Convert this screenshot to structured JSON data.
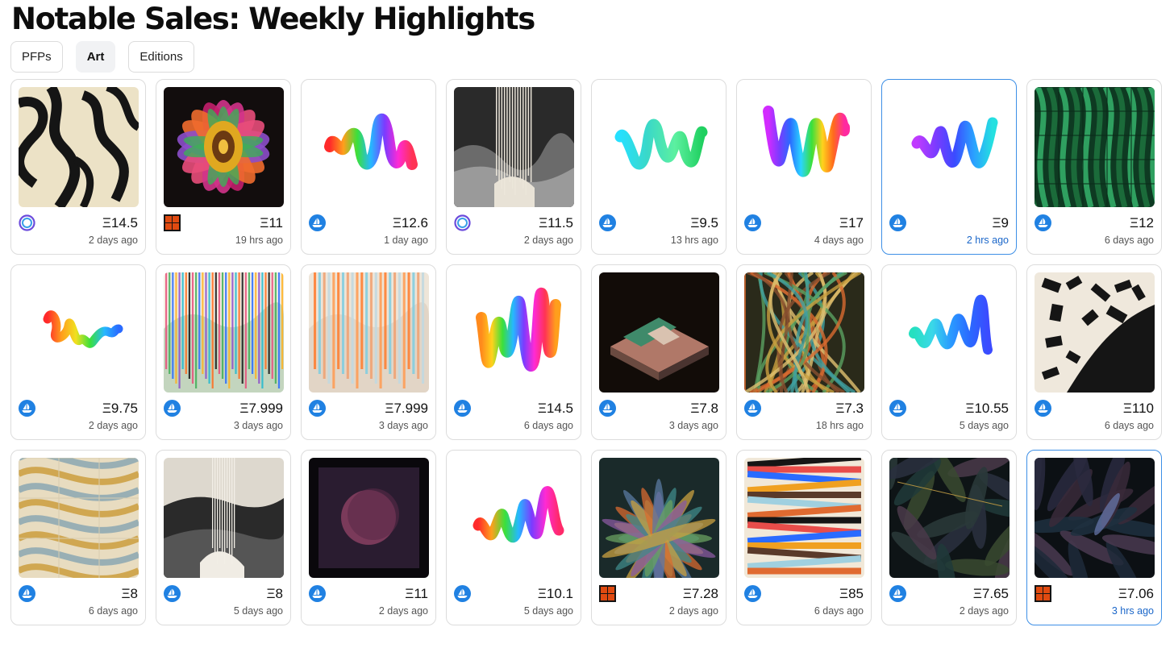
{
  "page": {
    "title": "Notable Sales: Weekly Highlights"
  },
  "tabs": [
    {
      "label": "PFPs",
      "active": false
    },
    {
      "label": "Art",
      "active": true
    },
    {
      "label": "Editions",
      "active": false
    }
  ],
  "colors": {
    "selected_border": "#3d8fe6",
    "selected_time": "#1a66c9",
    "opensea_blue": "#2081e2",
    "orange_badge": "#e04a10"
  },
  "sales": [
    {
      "price": "Ξ14.5",
      "time": "2 days ago",
      "marketplace_icon": "ring-icon",
      "artwork": "zebra-pattern",
      "selected": false
    },
    {
      "price": "Ξ11",
      "time": "19 hrs ago",
      "marketplace_icon": "orange-block-icon",
      "artwork": "psychedelic-flower",
      "selected": false
    },
    {
      "price": "Ξ12.6",
      "time": "1 day ago",
      "marketplace_icon": "opensea-icon",
      "artwork": "rainbow-squiggle",
      "selected": false
    },
    {
      "price": "Ξ11.5",
      "time": "2 days ago",
      "marketplace_icon": "ring-icon",
      "artwork": "grey-mountain-lines",
      "selected": false
    },
    {
      "price": "Ξ9.5",
      "time": "13 hrs ago",
      "marketplace_icon": "opensea-icon",
      "artwork": "cyan-squiggle",
      "selected": false
    },
    {
      "price": "Ξ17",
      "time": "4 days ago",
      "marketplace_icon": "opensea-icon",
      "artwork": "rainbow-squiggle-tall",
      "selected": false
    },
    {
      "price": "Ξ9",
      "time": "2 hrs ago",
      "marketplace_icon": "opensea-icon",
      "artwork": "purple-squiggle",
      "selected": true
    },
    {
      "price": "Ξ12",
      "time": "6 days ago",
      "marketplace_icon": "opensea-icon",
      "artwork": "green-malachite",
      "selected": false
    },
    {
      "price": "Ξ9.75",
      "time": "2 days ago",
      "marketplace_icon": "opensea-icon",
      "artwork": "small-rainbow-squiggle",
      "selected": false
    },
    {
      "price": "Ξ7.999",
      "time": "3 days ago",
      "marketplace_icon": "opensea-icon",
      "artwork": "color-vertical-lines",
      "selected": false
    },
    {
      "price": "Ξ7.999",
      "time": "3 days ago",
      "marketplace_icon": "opensea-icon",
      "artwork": "pastel-vertical-lines",
      "selected": false
    },
    {
      "price": "Ξ14.5",
      "time": "6 days ago",
      "marketplace_icon": "opensea-icon",
      "artwork": "rainbow-squiggle-tall-2",
      "selected": false
    },
    {
      "price": "Ξ7.8",
      "time": "3 days ago",
      "marketplace_icon": "opensea-icon",
      "artwork": "isometric-terrain",
      "selected": false
    },
    {
      "price": "Ξ7.3",
      "time": "18 hrs ago",
      "marketplace_icon": "opensea-icon",
      "artwork": "fibrous-organic",
      "selected": false
    },
    {
      "price": "Ξ10.55",
      "time": "5 days ago",
      "marketplace_icon": "opensea-icon",
      "artwork": "blue-green-squiggle",
      "selected": false
    },
    {
      "price": "Ξ110",
      "time": "6 days ago",
      "marketplace_icon": "opensea-icon",
      "artwork": "black-white-blocks",
      "selected": false
    },
    {
      "price": "Ξ8",
      "time": "6 days ago",
      "marketplace_icon": "opensea-icon",
      "artwork": "marble-tiles",
      "selected": false
    },
    {
      "price": "Ξ8",
      "time": "5 days ago",
      "marketplace_icon": "opensea-icon",
      "artwork": "mountain-lines-bw",
      "selected": false
    },
    {
      "price": "Ξ11",
      "time": "2 days ago",
      "marketplace_icon": "opensea-icon",
      "artwork": "dark-moon",
      "selected": false
    },
    {
      "price": "Ξ10.1",
      "time": "5 days ago",
      "marketplace_icon": "opensea-icon",
      "artwork": "rainbow-squiggle-3",
      "selected": false
    },
    {
      "price": "Ξ7.28",
      "time": "2 days ago",
      "marketplace_icon": "orange-block-icon",
      "artwork": "tropical-leaves",
      "selected": false
    },
    {
      "price": "Ξ85",
      "time": "6 days ago",
      "marketplace_icon": "opensea-icon",
      "artwork": "stacked-stripes",
      "selected": false
    },
    {
      "price": "Ξ7.65",
      "time": "2 days ago",
      "marketplace_icon": "opensea-icon",
      "artwork": "dark-leaves",
      "selected": false
    },
    {
      "price": "Ξ7.06",
      "time": "3 hrs ago",
      "marketplace_icon": "orange-block-icon",
      "artwork": "dark-leaves-2",
      "selected": true
    }
  ]
}
